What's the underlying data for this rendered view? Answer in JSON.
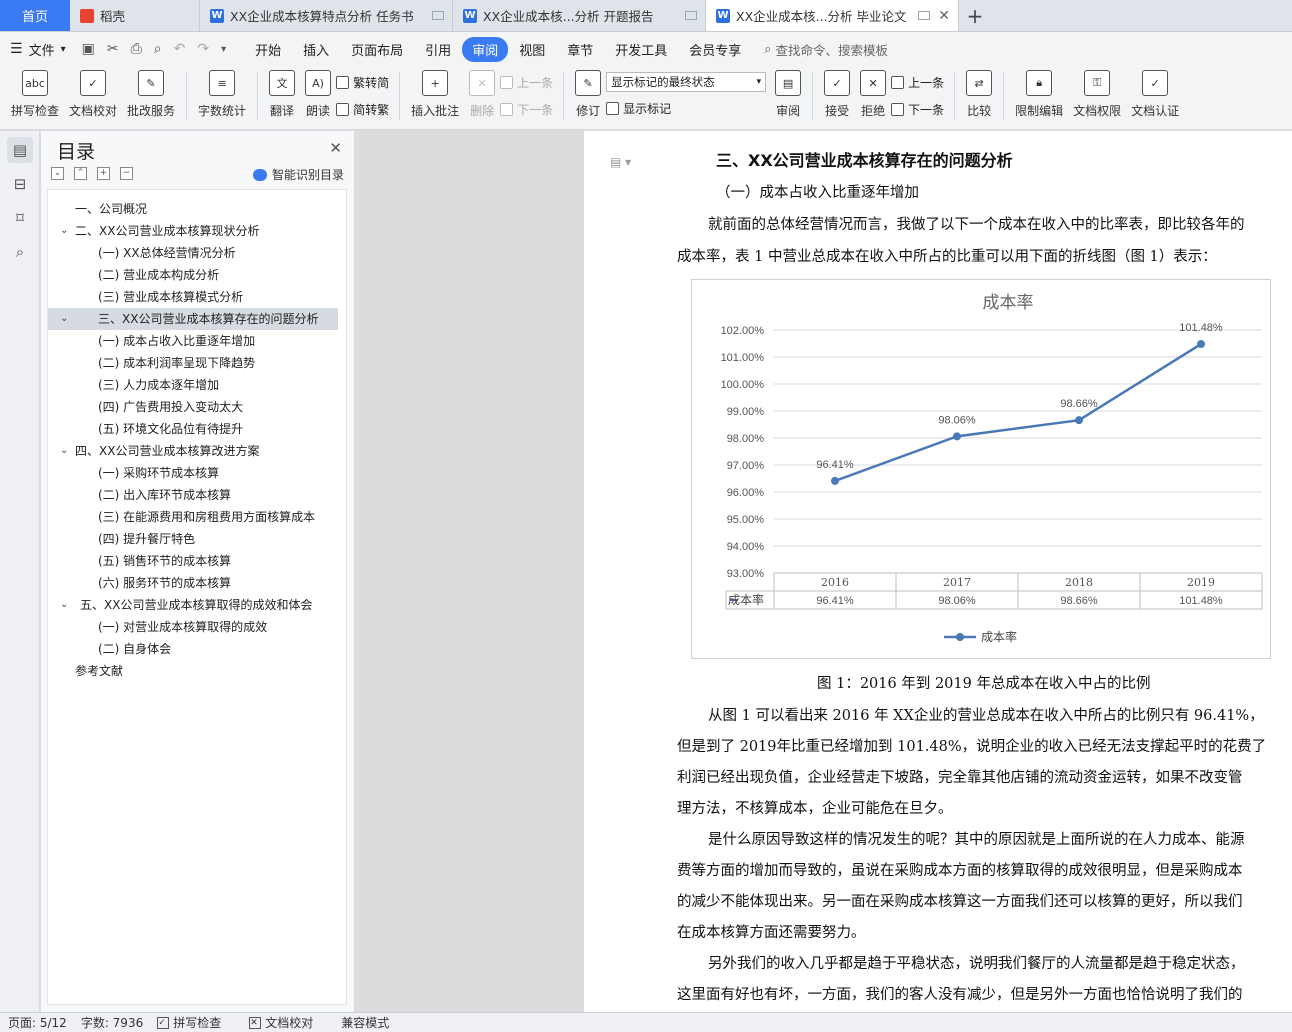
{
  "tabs": {
    "home": "首页",
    "daoke": "稻壳",
    "doc1": "XX企业成本核算特点分析 任务书",
    "doc2": "XX企业成本核...分析 开题报告",
    "doc3": "XX企业成本核...分析 毕业论文"
  },
  "menu": {
    "file": "文件",
    "items": [
      "开始",
      "插入",
      "页面布局",
      "引用",
      "审阅",
      "视图",
      "章节",
      "开发工具",
      "会员专享"
    ],
    "active": "审阅",
    "search": "查找命令、搜索模板"
  },
  "ribbon": {
    "spell": "拼写检查",
    "proof": "文档校对",
    "batch": "批改服务",
    "wordcount": "字数统计",
    "translate": "翻译",
    "read": "朗读",
    "t2s": "繁转简",
    "s2t": "简转繁",
    "insert_comment": "插入批注",
    "delete": "删除",
    "prev": "上一条",
    "next": "下一条",
    "revise": "修订",
    "markup_state": "显示标记的最终状态",
    "show_markup": "显示标记",
    "review": "审阅",
    "accept": "接受",
    "reject": "拒绝",
    "prev2": "上一条",
    "next2": "下一条",
    "compare": "比较",
    "restrict": "限制编辑",
    "perm": "文档权限",
    "cert": "文档认证"
  },
  "toc": {
    "title": "目录",
    "smart": "智能识别目录",
    "items": [
      "一、公司概况",
      "二、XX公司营业成本核算现状分析",
      "(一) XX总体经营情况分析",
      "(二) 营业成本构成分析",
      "(三) 营业成本核算模式分析",
      "三、XX公司营业成本核算存在的问题分析",
      "(一) 成本占收入比重逐年增加",
      "(二) 成本利润率呈现下降趋势",
      "(三) 人力成本逐年增加",
      "(四) 广告费用投入变动太大",
      "(五) 环境文化品位有待提升",
      "四、XX公司营业成本核算改进方案",
      "(一) 采购环节成本核算",
      "(二) 出入库环节成本核算",
      "(三) 在能源费用和房租费用方面核算成本",
      "(四) 提升餐厅特色",
      "(五) 销售环节的成本核算",
      "(六) 服务环节的成本核算",
      "五、XX公司营业成本核算取得的成效和体会",
      "(一) 对营业成本核算取得的成效",
      "(二) 自身体会",
      "参考文献"
    ]
  },
  "doc": {
    "heading": "三、XX公司营业成本核算存在的问题分析",
    "sub": "（一）成本占收入比重逐年增加",
    "p1_l1": "就前面的总体经营情况而言，我做了以下一个成本在收入中的比率表，即比较各年的",
    "p1_l2": "成本率，表 1 中营业总成本在收入中所占的比重可以用下面的折线图（图 1）表示：",
    "caption": "图 1：2016 年到 2019 年总成本在收入中占的比例",
    "p2_l1": "从图 1 可以看出来 2016 年 XX企业的营业总成本在收入中所占的比例只有 96.41%，",
    "p2_l2": "但是到了 2019年比重已经增加到 101.48%，说明企业的收入已经无法支撑起平时的花费了",
    "p2_l3": "利润已经出现负值，企业经营走下坡路，完全靠其他店铺的流动资金运转，如果不改变管",
    "p2_l4": "理方法，不核算成本，企业可能危在旦夕。",
    "p3_l1": "是什么原因导致这样的情况发生的呢？其中的原因就是上面所说的在人力成本、能源",
    "p3_l2": "费等方面的增加而导致的，虽说在采购成本方面的核算取得的成效很明显，但是采购成本",
    "p3_l3": "的减少不能体现出来。另一面在采购成本核算这一方面我们还可以核算的更好，所以我们",
    "p3_l4": "在成本核算方面还需要努力。",
    "p4_l1": "另外我们的收入几乎都是趋于平稳状态，说明我们餐厅的人流量都是趋于稳定状态，",
    "p4_l2": "这里面有好也有坏，一方面，我们的客人没有减少，但是另外一方面也恰恰说明了我们的"
  },
  "chart_data": {
    "type": "line",
    "title": "成本率",
    "categories": [
      "2016",
      "2017",
      "2018",
      "2019"
    ],
    "series": [
      {
        "name": "成本率",
        "values": [
          96.41,
          98.06,
          98.66,
          101.48
        ],
        "color": "#4a78b8"
      }
    ],
    "value_labels": [
      "96.41%",
      "98.06%",
      "98.66%",
      "101.48%"
    ],
    "y_ticks": [
      "93.00%",
      "94.00%",
      "95.00%",
      "96.00%",
      "97.00%",
      "98.00%",
      "99.00%",
      "100.00%",
      "101.00%",
      "102.00%"
    ],
    "ylim": [
      93,
      102
    ],
    "grid": true,
    "data_table": true,
    "legend": "bottom"
  },
  "status": {
    "page": "页面: 5/12",
    "words": "字数: 7936",
    "spell": "拼写检查",
    "proof": "文档校对",
    "compat": "兼容模式"
  }
}
